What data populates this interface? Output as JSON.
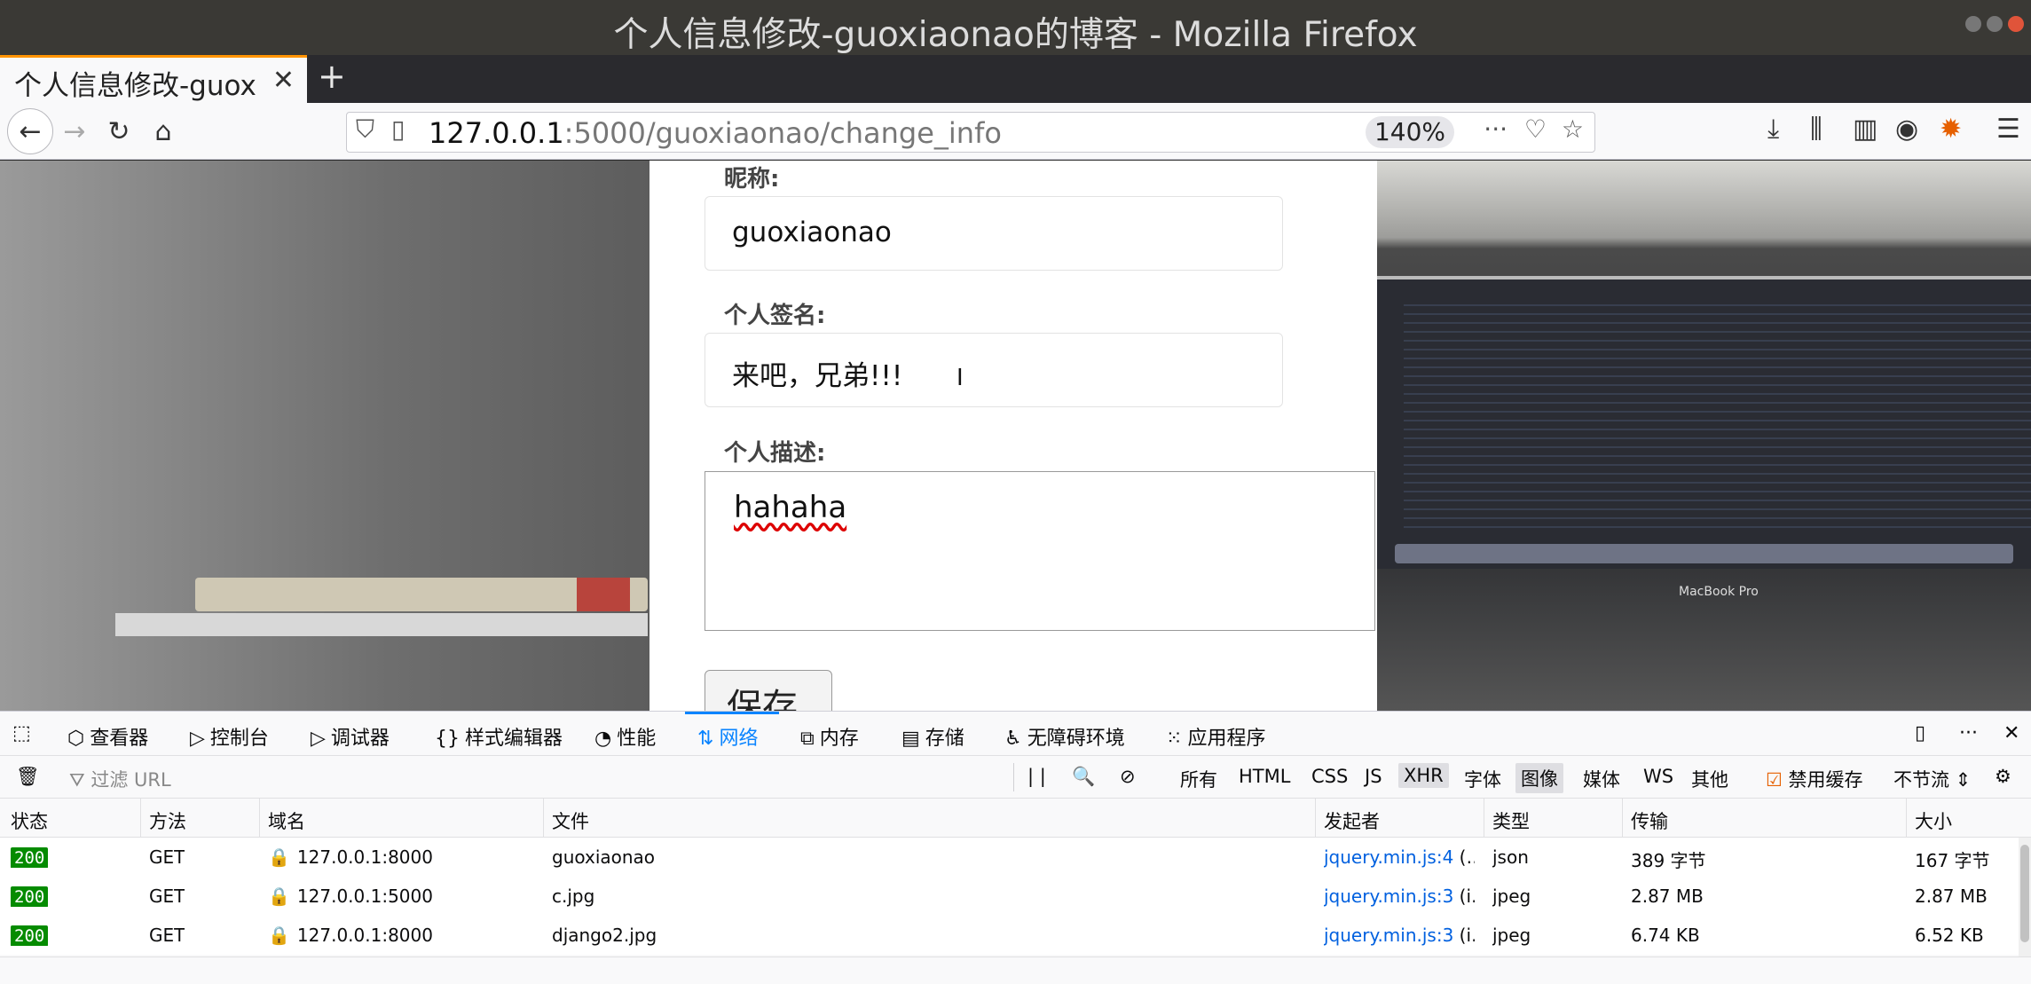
{
  "window": {
    "title": "个人信息修改-guoxiaonao的博客 - Mozilla Firefox"
  },
  "tabs": [
    {
      "label": "个人信息修改-guox"
    }
  ],
  "icons": {
    "back": "arrow-left-icon",
    "forward": "arrow-right-icon",
    "reload": "reload-icon",
    "home": "home-icon",
    "shield": "shield-icon",
    "page": "page-icon",
    "more": "more-icon",
    "pocket": "pocket-icon",
    "bookmark": "star-icon",
    "downloads": "download-icon",
    "library": "library-icon",
    "sidebar": "sidebar-icon",
    "account": "account-icon",
    "extension": "extension-icon",
    "menu": "hamburger-menu-icon"
  },
  "urlbar": {
    "host": "127.0.0.1",
    "path": ":5000/guoxiaonao/change_info",
    "zoom": "140%"
  },
  "form": {
    "nickname_label": "昵称:",
    "nickname_value": "guoxiaonao",
    "sign_label": "个人签名:",
    "sign_value": "来吧，兄弟!!!",
    "desc_label": "个人描述:",
    "desc_value": "hahaha",
    "save_label": "保存",
    "laptop_brand": "MacBook Pro"
  },
  "devtools": {
    "tabs": [
      "查看器",
      "控制台",
      "调试器",
      "样式编辑器",
      "性能",
      "网络",
      "内存",
      "存储",
      "无障碍环境",
      "应用程序"
    ],
    "active_tab": "网络",
    "filter_placeholder": "过滤 URL",
    "type_filters": [
      "所有",
      "HTML",
      "CSS",
      "JS",
      "XHR",
      "字体",
      "图像",
      "媒体",
      "WS",
      "其他"
    ],
    "selected_filters": [
      "XHR",
      "图像"
    ],
    "disable_cache": "禁用缓存",
    "throttle": "不节流 ⇕",
    "pause_label": "| |",
    "columns": [
      "状态",
      "方法",
      "域名",
      "文件",
      "发起者",
      "类型",
      "传输",
      "大小"
    ],
    "rows": [
      {
        "status": "200",
        "method": "GET",
        "domain": "127.0.0.1:8000",
        "file": "guoxiaonao",
        "initiator": "jquery.min.js:4",
        "initiator_extra": " (…",
        "type": "json",
        "transfer": "389 字节",
        "size": "167 字节"
      },
      {
        "status": "200",
        "method": "GET",
        "domain": "127.0.0.1:5000",
        "file": "c.jpg",
        "initiator": "jquery.min.js:3",
        "initiator_extra": " (i…",
        "type": "jpeg",
        "transfer": "2.87 MB",
        "size": "2.87 MB"
      },
      {
        "status": "200",
        "method": "GET",
        "domain": "127.0.0.1:8000",
        "file": "django2.jpg",
        "initiator": "jquery.min.js:3",
        "initiator_extra": " (i…",
        "type": "jpeg",
        "transfer": "6.74 KB",
        "size": "6.52 KB"
      }
    ]
  },
  "colors": {
    "accent": "#0a84ff",
    "status_ok": "#058b00",
    "tab_highlight": "#ff9400"
  }
}
